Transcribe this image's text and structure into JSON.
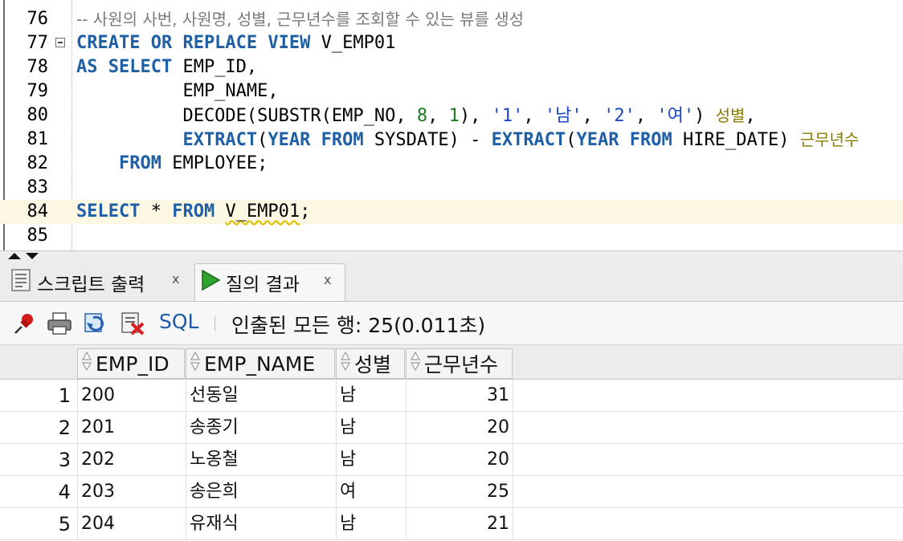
{
  "editor": {
    "lines": [
      {
        "num": "76",
        "parts": [
          {
            "t": "-- 사원의 사번, 사원명, 성별, 근무년수를 조회할 수 있는 뷰를 생성",
            "c": "cmt"
          }
        ]
      },
      {
        "num": "77",
        "parts": [
          {
            "t": "CREATE OR REPLACE VIEW ",
            "c": "kw"
          },
          {
            "t": "V_EMP01",
            "c": ""
          }
        ]
      },
      {
        "num": "78",
        "parts": [
          {
            "t": "AS SELECT ",
            "c": "kw"
          },
          {
            "t": "EMP_ID,",
            "c": ""
          }
        ]
      },
      {
        "num": "79",
        "parts": [
          {
            "t": "          EMP_NAME,",
            "c": ""
          }
        ]
      },
      {
        "num": "80",
        "parts": [
          {
            "t": "          DECODE(SUBSTR(EMP_NO, ",
            "c": ""
          },
          {
            "t": "8",
            "c": "num"
          },
          {
            "t": ", ",
            "c": ""
          },
          {
            "t": "1",
            "c": "num"
          },
          {
            "t": "), ",
            "c": ""
          },
          {
            "t": "'1'",
            "c": "str"
          },
          {
            "t": ", ",
            "c": ""
          },
          {
            "t": "'남'",
            "c": "str"
          },
          {
            "t": ", ",
            "c": ""
          },
          {
            "t": "'2'",
            "c": "str"
          },
          {
            "t": ", ",
            "c": ""
          },
          {
            "t": "'여'",
            "c": "str"
          },
          {
            "t": ") ",
            "c": ""
          },
          {
            "t": "성별",
            "c": "alias"
          },
          {
            "t": ",",
            "c": ""
          }
        ]
      },
      {
        "num": "81",
        "parts": [
          {
            "t": "          ",
            "c": ""
          },
          {
            "t": "EXTRACT",
            "c": "fn"
          },
          {
            "t": "(",
            "c": ""
          },
          {
            "t": "YEAR FROM ",
            "c": "kw"
          },
          {
            "t": "SYSDATE) - ",
            "c": ""
          },
          {
            "t": "EXTRACT",
            "c": "fn"
          },
          {
            "t": "(",
            "c": ""
          },
          {
            "t": "YEAR FROM ",
            "c": "kw"
          },
          {
            "t": "HIRE_DATE) ",
            "c": ""
          },
          {
            "t": "근무년수",
            "c": "alias"
          }
        ]
      },
      {
        "num": "82",
        "parts": [
          {
            "t": "    ",
            "c": ""
          },
          {
            "t": "FROM ",
            "c": "kw"
          },
          {
            "t": "EMPLOYEE;",
            "c": ""
          }
        ]
      },
      {
        "num": "83",
        "parts": []
      },
      {
        "num": "84",
        "parts": [
          {
            "t": "SELECT ",
            "c": "kw"
          },
          {
            "t": "* ",
            "c": ""
          },
          {
            "t": "FROM ",
            "c": "kw"
          },
          {
            "t": "V_EMP01",
            "c": "squig"
          },
          {
            "t": ";",
            "c": ""
          }
        ]
      },
      {
        "num": "85",
        "parts": []
      }
    ]
  },
  "tabs": {
    "script_output": "스크립트 출력",
    "query_result": "질의 결과",
    "close_glyph": "x"
  },
  "toolbar": {
    "sql_label": "SQL",
    "separator": "|",
    "status": "인출된 모든 행: 25(0.011초)"
  },
  "grid": {
    "columns": [
      "EMP_ID",
      "EMP_NAME",
      "성별",
      "근무년수"
    ],
    "rows": [
      {
        "n": "1",
        "emp_id": "200",
        "emp_name": "선동일",
        "gender": "남",
        "years": "31"
      },
      {
        "n": "2",
        "emp_id": "201",
        "emp_name": "송종기",
        "gender": "남",
        "years": "20"
      },
      {
        "n": "3",
        "emp_id": "202",
        "emp_name": "노옹철",
        "gender": "남",
        "years": "20"
      },
      {
        "n": "4",
        "emp_id": "203",
        "emp_name": "송은희",
        "gender": "여",
        "years": "25"
      },
      {
        "n": "5",
        "emp_id": "204",
        "emp_name": "유재식",
        "gender": "남",
        "years": "21"
      }
    ]
  },
  "colors": {
    "keyword": "#1f5fa6",
    "string": "#1a46c8",
    "number": "#1d7a1d",
    "alias": "#8a7a00",
    "comment": "#7a7a7a",
    "current_line": "#fdf8e4"
  }
}
